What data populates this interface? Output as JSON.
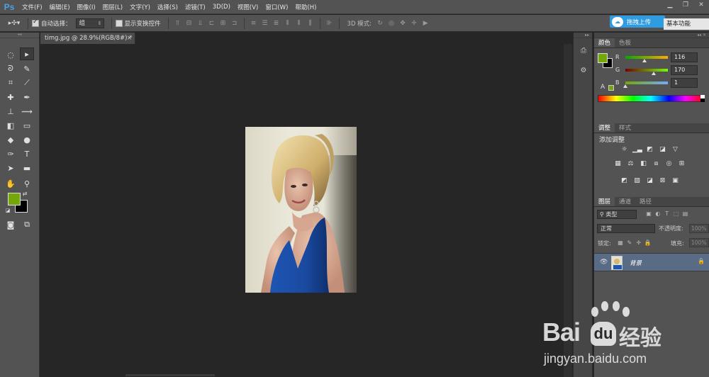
{
  "app": {
    "logo": "Ps"
  },
  "menu": [
    "文件(F)",
    "编辑(E)",
    "图像(I)",
    "图层(L)",
    "文字(Y)",
    "选择(S)",
    "滤镜(T)",
    "3D(D)",
    "视图(V)",
    "窗口(W)",
    "帮助(H)"
  ],
  "window_controls": {
    "minimize": "▁",
    "restore": "❐",
    "close": "✕"
  },
  "options": {
    "auto_select_label": "自动选择：",
    "auto_select_checked": true,
    "auto_select_value": "组",
    "show_transform_label": "显示变换控件",
    "show_transform_checked": false,
    "mode_3d_label": "3D 模式:"
  },
  "upload_button": {
    "label": "拖拽上传"
  },
  "workspace": {
    "value": "基本功能"
  },
  "document": {
    "tab_title": "timg.jpg @ 28.9%(RGB/8#) *",
    "close": "×"
  },
  "colors": {
    "foreground": "#74a70a",
    "background": "#000000",
    "accent_upload": "#2f9be0"
  },
  "color_panel": {
    "tabs": [
      "颜色",
      "色板"
    ],
    "active_tab": "颜色",
    "r": {
      "label": "R",
      "value": "116"
    },
    "g": {
      "label": "G",
      "value": "170"
    },
    "b": {
      "label": "B",
      "value": "1"
    },
    "warning_glyph": "A"
  },
  "adjust_panel": {
    "tabs": [
      "调整",
      "样式"
    ],
    "active_tab": "调整",
    "title": "添加调整"
  },
  "layers_panel": {
    "tabs": [
      "图层",
      "通道",
      "路径"
    ],
    "active_tab": "图层",
    "filter_label": "类型",
    "blend_mode": "正常",
    "opacity_label": "不透明度:",
    "opacity_value": "100%",
    "lock_label": "锁定:",
    "fill_label": "填充:",
    "fill_value": "100%",
    "layers": [
      {
        "name": "背景",
        "locked": true,
        "visible": true
      }
    ]
  },
  "watermark": {
    "brand": "Bai",
    "brand2": "经验",
    "url": "jingyan.baidu.com"
  }
}
